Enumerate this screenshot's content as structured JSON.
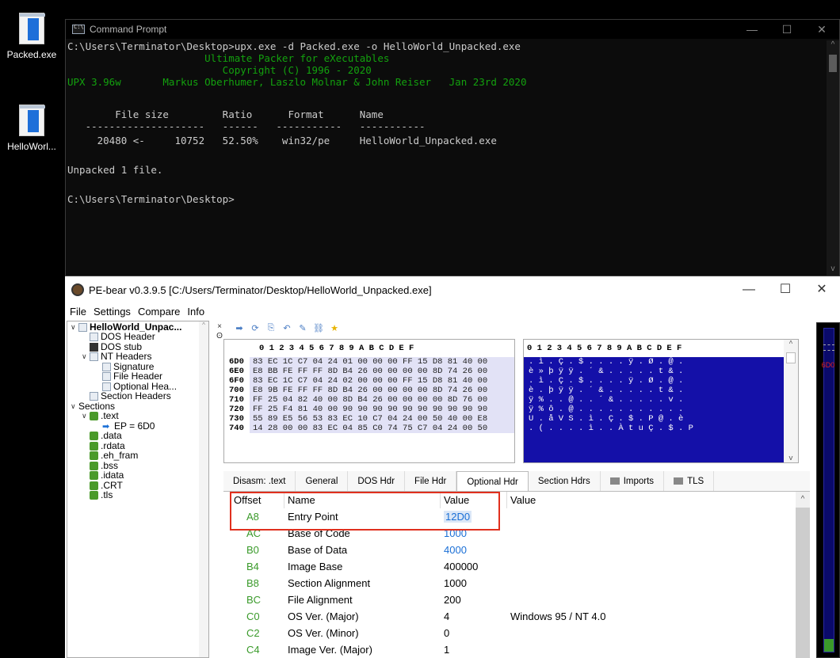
{
  "desktop": {
    "icons": [
      {
        "label": "Packed.exe"
      },
      {
        "label": "HelloWorl..."
      }
    ]
  },
  "cmd": {
    "title": "Command Prompt",
    "lines": [
      {
        "text": "C:\\Users\\Terminator\\Desktop>upx.exe -d Packed.exe -o HelloWorld_Unpacked.exe",
        "green": false
      },
      {
        "text": "                       Ultimate Packer for eXecutables",
        "green": true
      },
      {
        "text": "                          Copyright (C) 1996 - 2020",
        "green": true
      },
      {
        "text": "UPX 3.96w       Markus Oberhumer, Laszlo Molnar & John Reiser   Jan 23rd 2020",
        "green": true
      },
      {
        "text": "",
        "green": false
      },
      {
        "text": "        File size         Ratio      Format      Name",
        "green": false
      },
      {
        "text": "   --------------------   ------   -----------   -----------",
        "green": false
      },
      {
        "text": "     20480 <-     10752   52.50%    win32/pe     HelloWorld_Unpacked.exe",
        "green": false
      },
      {
        "text": "",
        "green": false
      },
      {
        "text": "Unpacked 1 file.",
        "green": false
      },
      {
        "text": "",
        "green": false
      },
      {
        "text": "C:\\Users\\Terminator\\Desktop>",
        "green": false
      }
    ],
    "controls": {
      "minimize": "—",
      "maximize": "☐",
      "close": "✕"
    }
  },
  "pebear": {
    "title": "PE-bear v0.3.9.5 [C:/Users/Terminator/Desktop/HelloWorld_Unpacked.exe]",
    "controls": {
      "minimize": "—",
      "maximize": "☐",
      "close": "✕"
    },
    "menu": [
      "File",
      "Settings",
      "Compare",
      "Info"
    ],
    "tree": [
      {
        "label": "HelloWorld_Unpac...",
        "indent": 0,
        "icon": "page",
        "expander": "∨",
        "bold": true
      },
      {
        "label": "DOS Header",
        "indent": 1,
        "icon": "page",
        "expander": ""
      },
      {
        "label": "DOS stub",
        "indent": 1,
        "icon": "dark",
        "expander": ""
      },
      {
        "label": "NT Headers",
        "indent": 1,
        "icon": "page",
        "expander": "∨"
      },
      {
        "label": "Signature",
        "indent": 2,
        "icon": "page",
        "expander": ""
      },
      {
        "label": "File Header",
        "indent": 2,
        "icon": "page",
        "expander": ""
      },
      {
        "label": "Optional Hea...",
        "indent": 2,
        "icon": "page",
        "expander": ""
      },
      {
        "label": "Section Headers",
        "indent": 1,
        "icon": "page",
        "expander": ""
      },
      {
        "label": "Sections",
        "indent": 0,
        "icon": "",
        "expander": "∨"
      },
      {
        "label": ".text",
        "indent": 1,
        "icon": "green",
        "expander": "∨"
      },
      {
        "label": "EP = 6D0",
        "indent": 2,
        "icon": "arrow",
        "expander": ""
      },
      {
        "label": ".data",
        "indent": 1,
        "icon": "green",
        "expander": ""
      },
      {
        "label": ".rdata",
        "indent": 1,
        "icon": "green",
        "expander": ""
      },
      {
        "label": ".eh_fram",
        "indent": 1,
        "icon": "green",
        "expander": ""
      },
      {
        "label": ".bss",
        "indent": 1,
        "icon": "green",
        "expander": ""
      },
      {
        "label": ".idata",
        "indent": 1,
        "icon": "green",
        "expander": ""
      },
      {
        "label": ".CRT",
        "indent": 1,
        "icon": "green",
        "expander": ""
      },
      {
        "label": ".tls",
        "indent": 1,
        "icon": "green",
        "expander": ""
      }
    ],
    "toolbar_icons": [
      "arrow-right-icon",
      "refresh-icon",
      "save-icon",
      "undo-icon",
      "pin-icon",
      "link-icon",
      "star-icon"
    ],
    "hex_header": "0 1 2 3 4 5 6 7 8 9 A B C D E F",
    "hex_rows": [
      {
        "addr": "6D0",
        "bytes": "83 EC 1C C7 04 24 01 00 00 00 FF 15 D8 81 40 00",
        "ascii": ". ì . Ç . $ . . . . ÿ . Ø . @ ."
      },
      {
        "addr": "6E0",
        "bytes": "E8 BB FE FF FF 8D B4 26 00 00 00 00 8D 74 26 00",
        "ascii": "è » þ ÿ ÿ . ´ & . . . . . t & ."
      },
      {
        "addr": "6F0",
        "bytes": "83 EC 1C C7 04 24 02 00 00 00 FF 15 D8 81 40 00",
        "ascii": ". ì . Ç . $ . . . . ÿ . Ø . @ ."
      },
      {
        "addr": "700",
        "bytes": "E8 9B FE FF FF 8D B4 26 00 00 00 00 8D 74 26 00",
        "ascii": "è . þ ÿ ÿ . ´ & . . . . . t & ."
      },
      {
        "addr": "710",
        "bytes": "FF 25 04 82 40 00 8D B4 26 00 00 00 00 8D 76 00",
        "ascii": "ÿ % . . @ . . ´ & . . . . . v ."
      },
      {
        "addr": "720",
        "bytes": "FF 25 F4 81 40 00 90 90 90 90 90 90 90 90 90 90",
        "ascii": "ÿ % ô . @ . . . . . . . . . . ."
      },
      {
        "addr": "730",
        "bytes": "55 89 E5 56 53 83 EC 10 C7 04 24 00 50 40 00 E8",
        "ascii": "U . å V S . ì . Ç . $ . P @ . è"
      },
      {
        "addr": "740",
        "bytes": "14 28 00 00 83 EC 04 85 C0 74 75 C7 04 24 00 50",
        "ascii": ". ( . . . . ì . . À t u Ç . $ . P"
      }
    ],
    "tabs": [
      {
        "label": "Disasm: .text",
        "active": false,
        "folder": false
      },
      {
        "label": "General",
        "active": false,
        "folder": false
      },
      {
        "label": "DOS Hdr",
        "active": false,
        "folder": false
      },
      {
        "label": "File Hdr",
        "active": false,
        "folder": false
      },
      {
        "label": "Optional Hdr",
        "active": true,
        "folder": false
      },
      {
        "label": "Section Hdrs",
        "active": false,
        "folder": false
      },
      {
        "label": "Imports",
        "active": false,
        "folder": true
      },
      {
        "label": "TLS",
        "active": false,
        "folder": true
      }
    ],
    "table": {
      "columns": [
        "Offset",
        "Name",
        "Value",
        "Value"
      ],
      "rows": [
        {
          "offset": "A8",
          "name": "Entry Point",
          "value": "12D0",
          "value2": "",
          "value_style": "highlight"
        },
        {
          "offset": "AC",
          "name": "Base of Code",
          "value": "1000",
          "value2": "",
          "value_style": "blue"
        },
        {
          "offset": "B0",
          "name": "Base of Data",
          "value": "4000",
          "value2": "",
          "value_style": "blue"
        },
        {
          "offset": "B4",
          "name": "Image Base",
          "value": "400000",
          "value2": "",
          "value_style": ""
        },
        {
          "offset": "B8",
          "name": "Section Alignment",
          "value": "1000",
          "value2": "",
          "value_style": ""
        },
        {
          "offset": "BC",
          "name": "File Alignment",
          "value": "200",
          "value2": "",
          "value_style": ""
        },
        {
          "offset": "C0",
          "name": "OS Ver. (Major)",
          "value": "4",
          "value2": "Windows 95 / NT 4.0",
          "value_style": ""
        },
        {
          "offset": "C2",
          "name": "OS Ver. (Minor)",
          "value": "0",
          "value2": "",
          "value_style": ""
        },
        {
          "offset": "C4",
          "name": "Image Ver. (Major)",
          "value": "1",
          "value2": "",
          "value_style": ""
        }
      ]
    },
    "side_tools": [
      "×",
      "ʘ"
    ],
    "strip_label": "6D0",
    "colors": {
      "hex_ascii_bg": "#1410a8",
      "offset_green": "#3a9a2a",
      "highlight_red": "#e0301e",
      "value_blue": "#1a6fd6"
    }
  }
}
